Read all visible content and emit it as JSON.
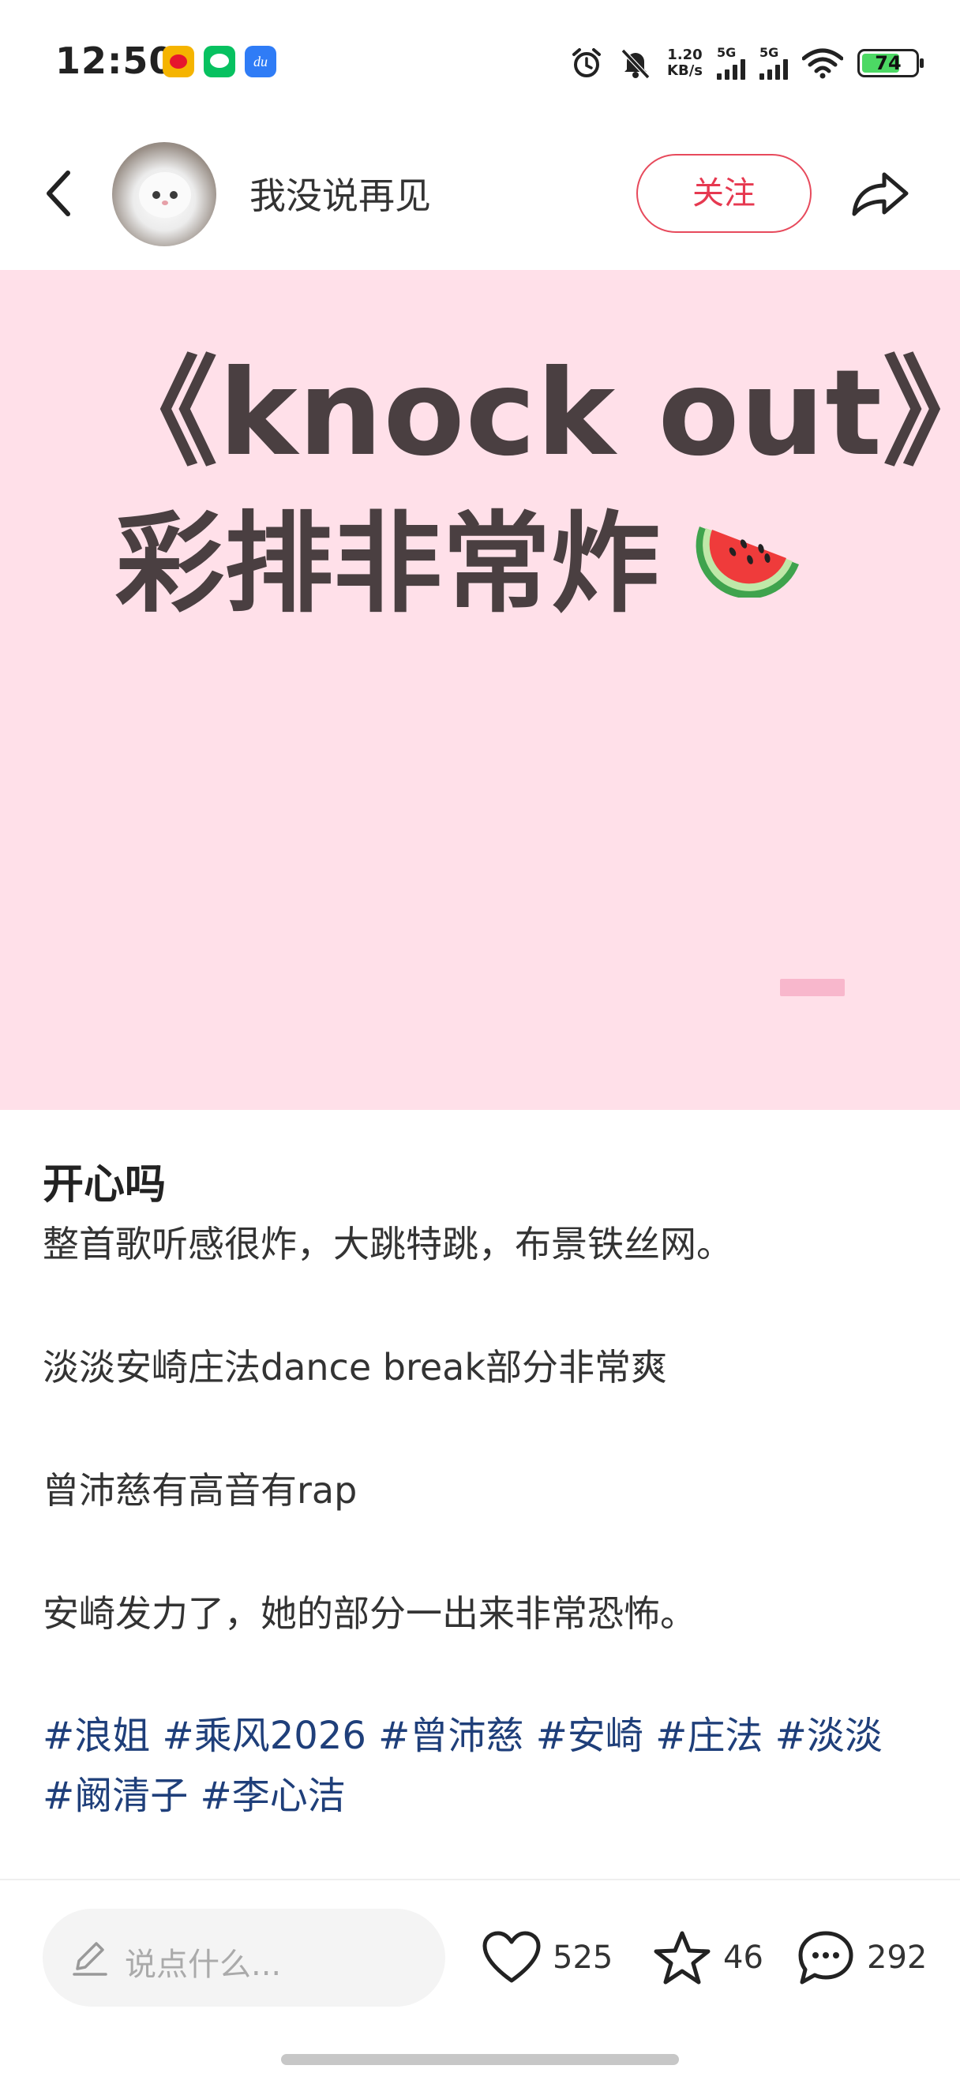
{
  "status_bar": {
    "time": "12:50",
    "net_speed_value": "1.20",
    "net_speed_unit": "KB/s",
    "sim1_label": "5G",
    "sim2_label": "5G",
    "battery_level": "74",
    "app_icons": [
      "weibo-icon",
      "wechat-icon",
      "du-icon"
    ],
    "system_icons": [
      "alarm-icon",
      "mute-icon",
      "wifi-icon"
    ]
  },
  "header": {
    "author_name": "我没说再见",
    "follow_label": "关注"
  },
  "cover": {
    "line1": "《knock out》",
    "line2": "彩排非常炸",
    "emoji": "🍉",
    "background": "#ffe0e9"
  },
  "post": {
    "title": "开心吗",
    "paragraphs": [
      "整首歌听感很炸，大跳特跳，布景铁丝网。",
      "淡淡安崎庄法dance break部分非常爽",
      "曾沛慈有高音有rap",
      "安崎发力了，她的部分一出来非常恐怖。"
    ],
    "tags": [
      "#浪姐",
      "#乘风2026",
      "#曾沛慈",
      "#安崎",
      "#庄法",
      "#淡淡",
      "#阚清子",
      "#李心洁"
    ]
  },
  "bottom_bar": {
    "comment_placeholder": "说点什么...",
    "likes": "525",
    "favorites": "46",
    "comments": "292"
  },
  "colors": {
    "accent": "#e63950",
    "tag": "#1f3f7a",
    "cover_text": "#4a3f41"
  }
}
